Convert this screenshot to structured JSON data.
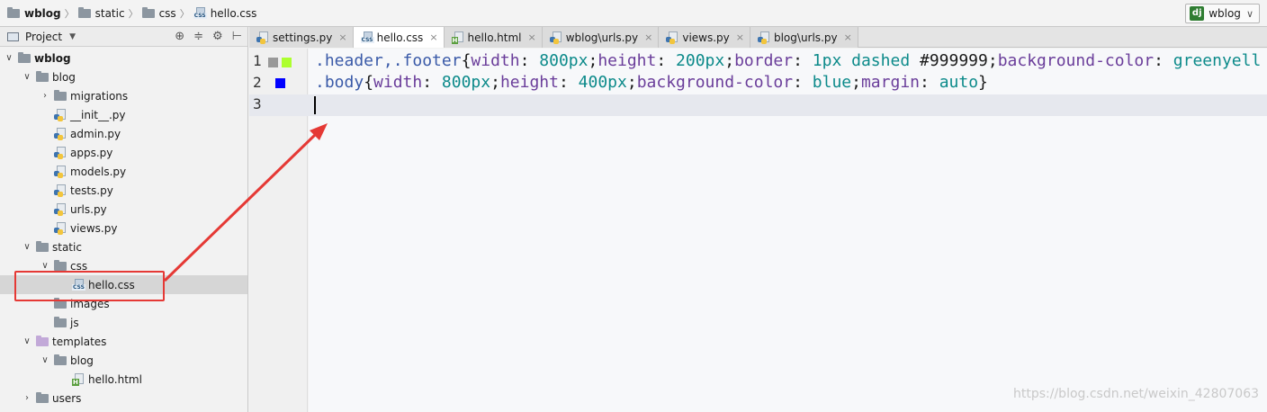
{
  "breadcrumb": [
    {
      "label": "wblog",
      "icon": "folder-icon",
      "bold": true
    },
    {
      "label": "static",
      "icon": "folder-icon"
    },
    {
      "label": "css",
      "icon": "folder-icon"
    },
    {
      "label": "hello.css",
      "icon": "css-file-icon"
    }
  ],
  "run_config": {
    "label": "wblog",
    "icon": "django-icon"
  },
  "project_panel": {
    "title": "Project",
    "tree": [
      {
        "label": "wblog",
        "depth": 0,
        "expanded": true,
        "icon": "folder-icon",
        "bold": true
      },
      {
        "label": "blog",
        "depth": 1,
        "expanded": true,
        "icon": "folder-icon"
      },
      {
        "label": "migrations",
        "depth": 2,
        "expanded": false,
        "icon": "folder-icon"
      },
      {
        "label": "__init__.py",
        "depth": 2,
        "icon": "python-file-icon"
      },
      {
        "label": "admin.py",
        "depth": 2,
        "icon": "python-file-icon"
      },
      {
        "label": "apps.py",
        "depth": 2,
        "icon": "python-file-icon"
      },
      {
        "label": "models.py",
        "depth": 2,
        "icon": "python-file-icon"
      },
      {
        "label": "tests.py",
        "depth": 2,
        "icon": "python-file-icon"
      },
      {
        "label": "urls.py",
        "depth": 2,
        "icon": "python-file-icon"
      },
      {
        "label": "views.py",
        "depth": 2,
        "icon": "python-file-icon"
      },
      {
        "label": "static",
        "depth": 1,
        "expanded": true,
        "icon": "folder-icon"
      },
      {
        "label": "css",
        "depth": 2,
        "expanded": true,
        "icon": "folder-icon"
      },
      {
        "label": "hello.css",
        "depth": 3,
        "icon": "css-file-icon",
        "selected": true
      },
      {
        "label": "images",
        "depth": 2,
        "icon": "folder-icon"
      },
      {
        "label": "js",
        "depth": 2,
        "icon": "folder-icon"
      },
      {
        "label": "templates",
        "depth": 1,
        "expanded": true,
        "icon": "folder-icon",
        "purple": true
      },
      {
        "label": "blog",
        "depth": 2,
        "expanded": true,
        "icon": "folder-icon"
      },
      {
        "label": "hello.html",
        "depth": 3,
        "icon": "html-file-icon"
      },
      {
        "label": "users",
        "depth": 1,
        "expanded": false,
        "icon": "folder-icon"
      }
    ]
  },
  "tabs": [
    {
      "label": "settings.py",
      "icon": "python-file-icon"
    },
    {
      "label": "hello.css",
      "icon": "css-file-icon",
      "active": true
    },
    {
      "label": "hello.html",
      "icon": "html-file-icon"
    },
    {
      "label": "wblog\\urls.py",
      "icon": "python-file-icon"
    },
    {
      "label": "views.py",
      "icon": "python-file-icon"
    },
    {
      "label": "blog\\urls.py",
      "icon": "python-file-icon"
    }
  ],
  "editor": {
    "line_numbers": [
      "1",
      "2",
      "3"
    ],
    "colors": {
      "gray": "#999999",
      "greenyellow": "#adff2f",
      "blue": "#0000ff"
    },
    "lines": [
      [
        {
          "t": ".header,.footer",
          "c": "sel"
        },
        {
          "t": "{",
          "c": ""
        },
        {
          "t": "width",
          "c": "prop"
        },
        {
          "t": ": ",
          "c": ""
        },
        {
          "t": "800px",
          "c": "val"
        },
        {
          "t": ";",
          "c": ""
        },
        {
          "t": "height",
          "c": "prop"
        },
        {
          "t": ": ",
          "c": ""
        },
        {
          "t": "200px",
          "c": "val"
        },
        {
          "t": ";",
          "c": ""
        },
        {
          "t": "border",
          "c": "prop"
        },
        {
          "t": ": ",
          "c": ""
        },
        {
          "t": "1px dashed",
          "c": "val"
        },
        {
          "t": " ",
          "c": ""
        },
        {
          "t": "#999999",
          "c": ""
        },
        {
          "t": ";",
          "c": ""
        },
        {
          "t": "background-color",
          "c": "prop"
        },
        {
          "t": ": ",
          "c": ""
        },
        {
          "t": "greenyell",
          "c": "val"
        }
      ],
      [
        {
          "t": ".body",
          "c": "sel"
        },
        {
          "t": "{",
          "c": ""
        },
        {
          "t": "width",
          "c": "prop"
        },
        {
          "t": ": ",
          "c": ""
        },
        {
          "t": "800px",
          "c": "val"
        },
        {
          "t": ";",
          "c": ""
        },
        {
          "t": "height",
          "c": "prop"
        },
        {
          "t": ": ",
          "c": ""
        },
        {
          "t": "400px",
          "c": "val"
        },
        {
          "t": ";",
          "c": ""
        },
        {
          "t": "background-color",
          "c": "prop"
        },
        {
          "t": ": ",
          "c": ""
        },
        {
          "t": "blue",
          "c": "val"
        },
        {
          "t": ";",
          "c": ""
        },
        {
          "t": "margin",
          "c": "prop"
        },
        {
          "t": ": ",
          "c": ""
        },
        {
          "t": "auto",
          "c": "val"
        },
        {
          "t": "}",
          "c": ""
        }
      ],
      []
    ]
  },
  "watermark": "https://blog.csdn.net/weixin_42807063"
}
